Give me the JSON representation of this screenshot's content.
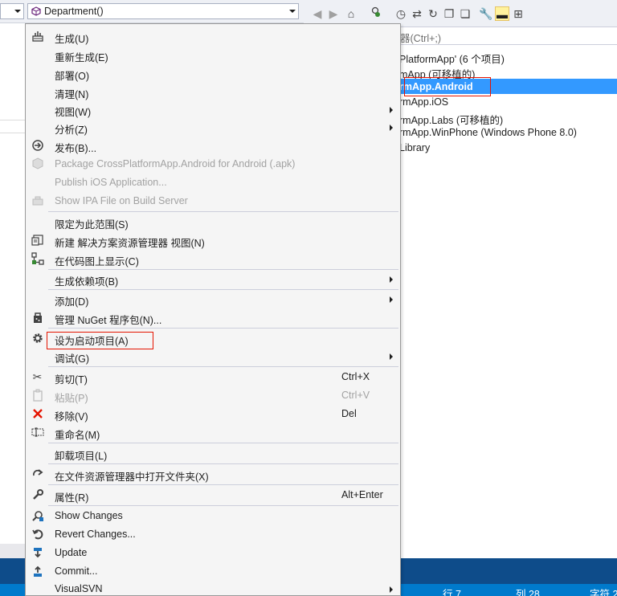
{
  "editor": {
    "type_dropdown": {
      "value": ""
    },
    "member_dropdown": {
      "value": "Department()",
      "icon": "method-icon"
    }
  },
  "solution_explorer": {
    "search_placeholder": "搜索解决方案资源管理器(Ctrl+;)",
    "search_visible": "器(Ctrl+;)",
    "tree": [
      {
        "text": "PlatformApp' (6 个项目)",
        "selected": false
      },
      {
        "text": "mApp (可移植的)",
        "selected": false
      },
      {
        "text": "rmApp.Android",
        "selected": true
      },
      {
        "text": "rmApp.iOS",
        "selected": false
      },
      {
        "text": "rmApp.Labs (可移植的)",
        "selected": false
      },
      {
        "text": "rmApp.WinPhone (Windows Phone 8.0)",
        "selected": false
      },
      {
        "text": "Library",
        "selected": false
      }
    ]
  },
  "context_menu": {
    "items": [
      {
        "id": "build",
        "label": "生成(U)",
        "icon": "build-icon"
      },
      {
        "id": "rebuild",
        "label": "重新生成(E)"
      },
      {
        "id": "deploy",
        "label": "部署(O)"
      },
      {
        "id": "clean",
        "label": "清理(N)"
      },
      {
        "id": "view",
        "label": "视图(W)",
        "submenu": true
      },
      {
        "id": "analyze",
        "label": "分析(Z)",
        "submenu": true
      },
      {
        "id": "publish",
        "label": "发布(B)...",
        "icon": "publish-icon"
      },
      {
        "id": "package",
        "label": "Package CrossPlatformApp.Android for Android (.apk)",
        "disabled": true,
        "icon": "package-icon"
      },
      {
        "id": "publish-ios",
        "label": "Publish iOS Application...",
        "disabled": true
      },
      {
        "id": "show-ipa",
        "label": "Show IPA File on Build Server",
        "disabled": true,
        "icon": "server-icon"
      },
      {
        "id": "scope",
        "label": "限定为此范围(S)"
      },
      {
        "id": "new-view",
        "label": "新建 解决方案资源管理器 视图(N)",
        "icon": "new-view-icon"
      },
      {
        "id": "code-map",
        "label": "在代码图上显示(C)",
        "icon": "code-map-icon"
      },
      {
        "id": "build-deps",
        "label": "生成依赖项(B)",
        "submenu": true
      },
      {
        "id": "add",
        "label": "添加(D)",
        "submenu": true
      },
      {
        "id": "nuget",
        "label": "管理 NuGet 程序包(N)...",
        "icon": "nuget-icon"
      },
      {
        "id": "startup",
        "label": "设为启动项目(A)",
        "icon": "gear-icon"
      },
      {
        "id": "debug",
        "label": "调试(G)",
        "submenu": true
      },
      {
        "id": "cut",
        "label": "剪切(T)",
        "shortcut": "Ctrl+X",
        "icon": "scissors-icon"
      },
      {
        "id": "paste",
        "label": "粘贴(P)",
        "shortcut": "Ctrl+V",
        "disabled": true,
        "icon": "paste-icon"
      },
      {
        "id": "remove",
        "label": "移除(V)",
        "shortcut": "Del",
        "icon": "remove-icon"
      },
      {
        "id": "rename",
        "label": "重命名(M)",
        "icon": "rename-icon"
      },
      {
        "id": "unload",
        "label": "卸载项目(L)"
      },
      {
        "id": "open-folder",
        "label": "在文件资源管理器中打开文件夹(X)",
        "icon": "open-folder-icon"
      },
      {
        "id": "properties",
        "label": "属性(R)",
        "shortcut": "Alt+Enter",
        "icon": "wrench-icon"
      },
      {
        "id": "show-changes",
        "label": "Show Changes",
        "icon": "show-changes-icon"
      },
      {
        "id": "revert",
        "label": "Revert Changes...",
        "icon": "revert-icon"
      },
      {
        "id": "update",
        "label": "Update",
        "icon": "update-icon"
      },
      {
        "id": "commit",
        "label": "Commit...",
        "icon": "commit-icon"
      },
      {
        "id": "visualsvn",
        "label": "VisualSVN",
        "submenu": true
      }
    ]
  },
  "status_bar": {
    "line": "行 7",
    "col": "列 28",
    "char": "字符 2"
  },
  "colors": {
    "menu_bg": "#f5f5f5",
    "selection": "#3399ff",
    "highlight_box": "#e51400",
    "status_bar": "#007acc"
  }
}
